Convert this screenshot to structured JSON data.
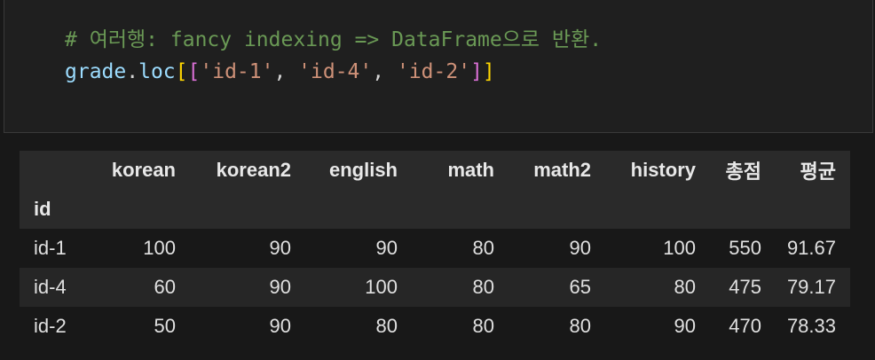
{
  "code": {
    "comment": "# 여러행: fancy indexing => DataFrame으로 반환.",
    "obj": "grade",
    "dot": ".",
    "method": "loc",
    "open_outer": "[",
    "open_inner": "[",
    "arg1": "'id-1'",
    "arg2": "'id-4'",
    "arg3": "'id-2'",
    "sep": ", ",
    "close_inner": "]",
    "close_outer": "]"
  },
  "table": {
    "index_name": "id",
    "columns": [
      "korean",
      "korean2",
      "english",
      "math",
      "math2",
      "history",
      "총점",
      "평균"
    ],
    "rows": [
      {
        "index": "id-1",
        "values": [
          "100",
          "90",
          "90",
          "80",
          "90",
          "100",
          "550",
          "91.67"
        ]
      },
      {
        "index": "id-4",
        "values": [
          "60",
          "90",
          "100",
          "80",
          "65",
          "80",
          "475",
          "79.17"
        ]
      },
      {
        "index": "id-2",
        "values": [
          "50",
          "90",
          "80",
          "80",
          "80",
          "90",
          "470",
          "78.33"
        ]
      }
    ]
  }
}
